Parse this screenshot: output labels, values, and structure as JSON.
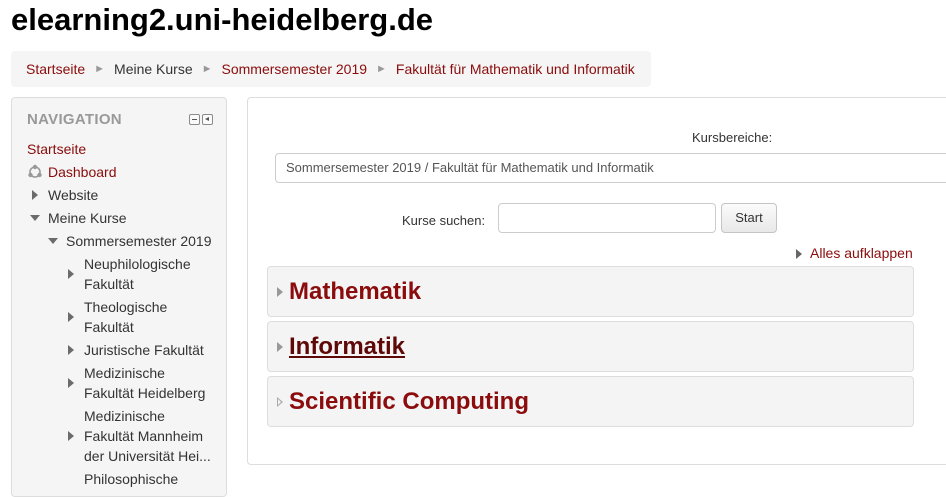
{
  "site": {
    "title": "elearning2.uni-heidelberg.de"
  },
  "breadcrumb": {
    "items": [
      "Startseite",
      "Meine Kurse",
      "Sommersemester 2019",
      "Fakultät für Mathematik und Informatik"
    ],
    "separator": "►"
  },
  "navigation": {
    "header": "NAVIGATION",
    "home": "Startseite",
    "dashboard": "Dashboard",
    "website": "Website",
    "my_courses": "Meine Kurse",
    "semester": "Sommersemester 2019",
    "faculties": [
      {
        "line1": "Neuphilologische",
        "line2": "Fakultät"
      },
      {
        "line1": "Theologische",
        "line2": "Fakultät"
      },
      {
        "line1": "Juristische Fakultät"
      },
      {
        "line1": "Medizinische",
        "line2": "Fakultät Heidelberg"
      },
      {
        "line1": "Medizinische",
        "line2": "Fakultät Mannheim",
        "line3": "der Universität Hei..."
      },
      {
        "line1": "Philosophische"
      }
    ]
  },
  "main": {
    "categories_label": "Kursbereiche:",
    "categories_selected": "Sommersemester 2019 / Fakultät für Mathematik und Informatik",
    "search_label": "Kurse suchen:",
    "search_value": "",
    "search_button": "Start",
    "expand_all": "Alles aufklappen",
    "categories": [
      "Mathematik",
      "Informatik",
      "Scientific Computing"
    ]
  },
  "colors": {
    "link": "#8a0c0c",
    "nav_bg": "#f5f5f5",
    "category_bg": "#f4f4f4"
  }
}
